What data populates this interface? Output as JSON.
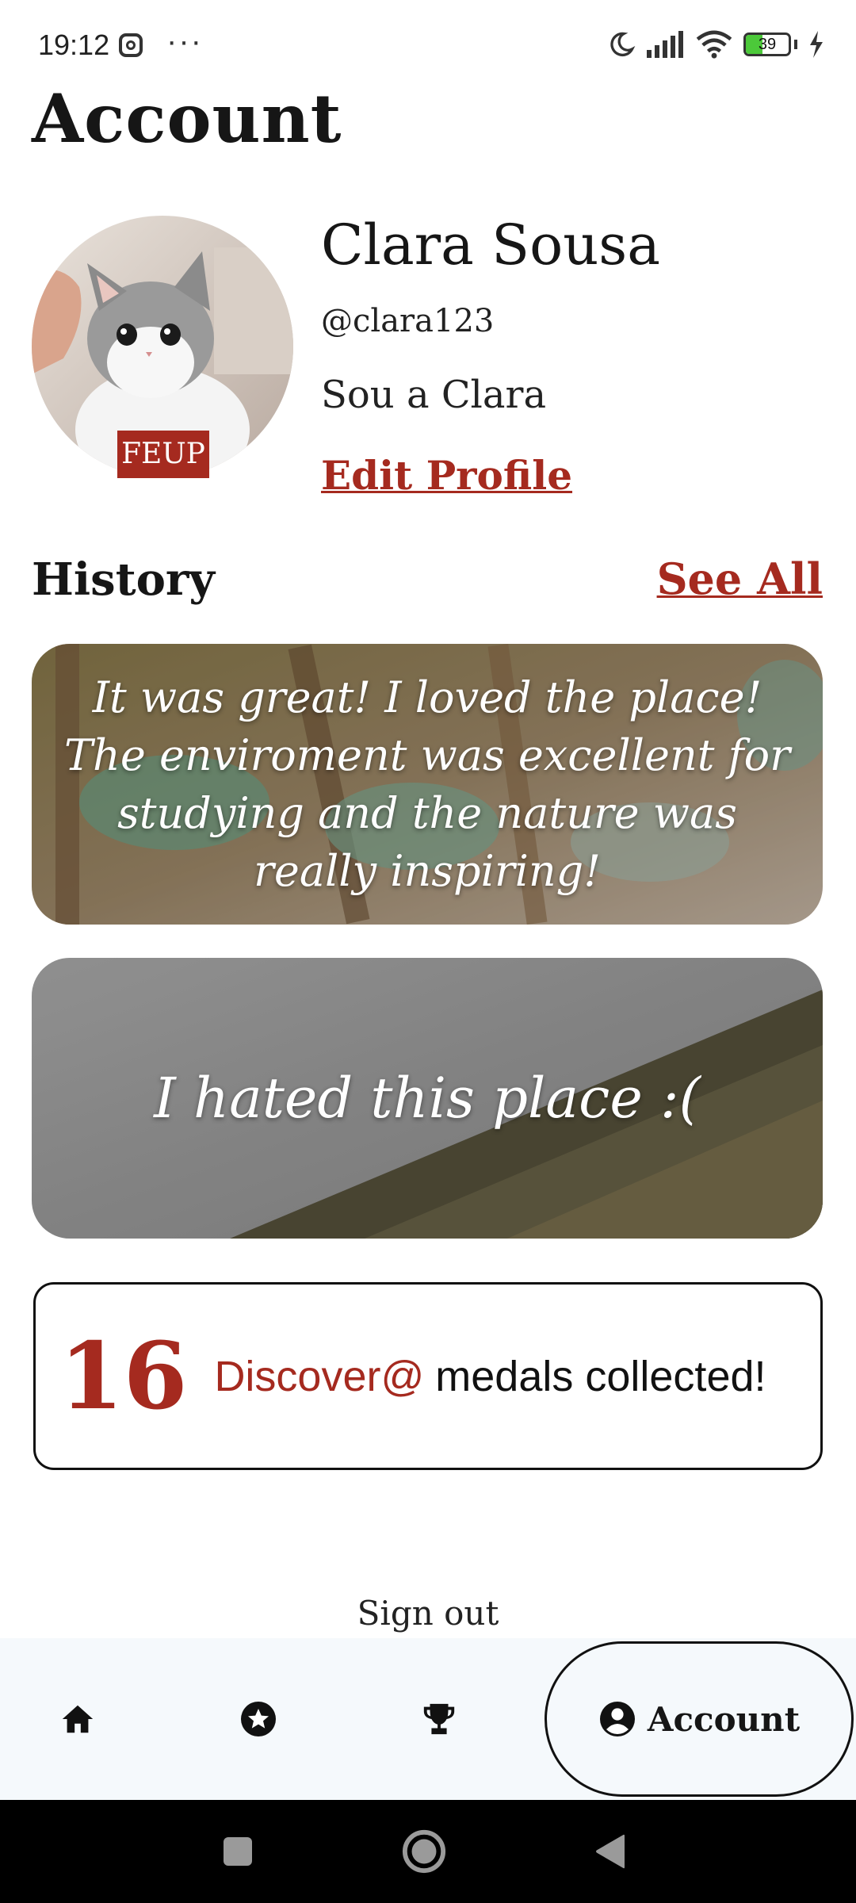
{
  "status_bar": {
    "time": "19:12",
    "more": "···",
    "battery": "39",
    "battery_level": 0.39,
    "icons": [
      "instagram-icon",
      "moon-icon",
      "signal-icon",
      "wifi-icon",
      "battery-icon",
      "charging-icon"
    ]
  },
  "page": {
    "title": "Account"
  },
  "profile": {
    "name": "Clara Sousa",
    "handle": "@clara123",
    "bio": "Sou a Clara",
    "badge": "FEUP",
    "edit_label": "Edit Profile"
  },
  "history": {
    "title": "History",
    "see_all_label": "See All",
    "items": [
      {
        "text": "It was great! I loved the place! The enviroment was excellent for studying and the nature was really inspiring!"
      },
      {
        "text": "I hated this place :("
      }
    ]
  },
  "medals": {
    "count": "16",
    "brand": "Discover@",
    "label": "medals collected!"
  },
  "sign_out_label": "Sign out",
  "nav": {
    "items": [
      {
        "icon": "home-icon"
      },
      {
        "icon": "star-icon"
      },
      {
        "icon": "trophy-icon"
      },
      {
        "icon": "account-icon",
        "label": "Account"
      }
    ]
  },
  "colors": {
    "accent": "#a52a1f",
    "text": "#161616",
    "nav_background": "#f5f9fc"
  }
}
